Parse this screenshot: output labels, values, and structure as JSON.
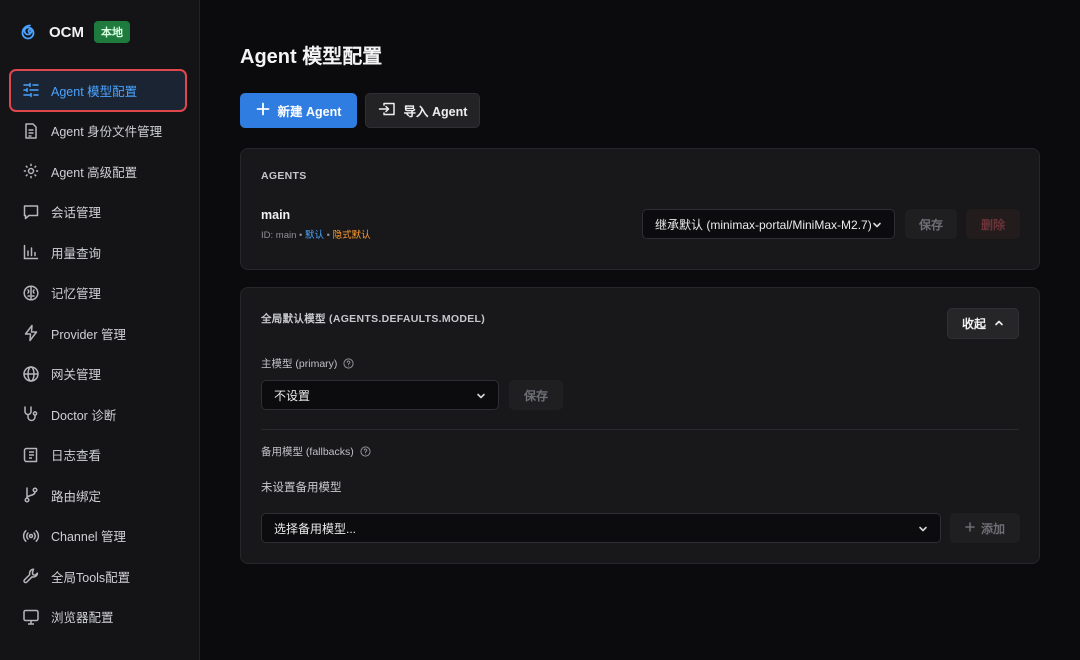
{
  "app": {
    "name": "OCM",
    "badge": "本地",
    "logo_icon": "spiral-logo-icon"
  },
  "sidebar": {
    "items": [
      {
        "label": "Agent 模型配置",
        "icon": "sliders-icon",
        "active": true
      },
      {
        "label": "Agent 身份文件管理",
        "icon": "document-icon"
      },
      {
        "label": "Agent 高级配置",
        "icon": "gear-icon"
      },
      {
        "label": "会话管理",
        "icon": "chat-icon"
      },
      {
        "label": "用量查询",
        "icon": "bar-chart-icon"
      },
      {
        "label": "记忆管理",
        "icon": "brain-icon"
      },
      {
        "label": "Provider 管理",
        "icon": "lightning-icon"
      },
      {
        "label": "网关管理",
        "icon": "globe-icon"
      },
      {
        "label": "Doctor 诊断",
        "icon": "stethoscope-icon"
      },
      {
        "label": "日志查看",
        "icon": "log-icon"
      },
      {
        "label": "路由绑定",
        "icon": "git-branch-icon"
      },
      {
        "label": "Channel 管理",
        "icon": "broadcast-icon"
      },
      {
        "label": "全局Tools配置",
        "icon": "wrench-icon"
      },
      {
        "label": "浏览器配置",
        "icon": "monitor-icon"
      }
    ]
  },
  "main": {
    "title": "Agent 模型配置",
    "new_agent_label": "新建 Agent",
    "import_agent_label": "导入 Agent",
    "agents_card": {
      "section_label": "AGENTS",
      "agent": {
        "name": "main",
        "id_text": "ID: main",
        "sep": " • ",
        "default_tag": "默认",
        "implicit_tag": "隐式默认",
        "model_select": "继承默认 (minimax-portal/MiniMax-M2.7)",
        "save_label": "保存",
        "delete_label": "删除"
      }
    },
    "defaults_card": {
      "section_label": "全局默认模型 (AGENTS.DEFAULTS.MODEL)",
      "collapse_label": "收起",
      "primary_label": "主模型 (primary)",
      "primary_select": "不设置",
      "primary_save_label": "保存",
      "fallbacks_label": "备用模型 (fallbacks)",
      "fallbacks_empty": "未设置备用模型",
      "fallback_select": "选择备用模型...",
      "add_label": "添加"
    }
  },
  "colors": {
    "accent": "#2f7de1",
    "active_text": "#4aa3ff",
    "badge_green": "#1f7a3d",
    "highlight_border": "#e0474c",
    "implicit_orange": "#ff9a2e"
  }
}
